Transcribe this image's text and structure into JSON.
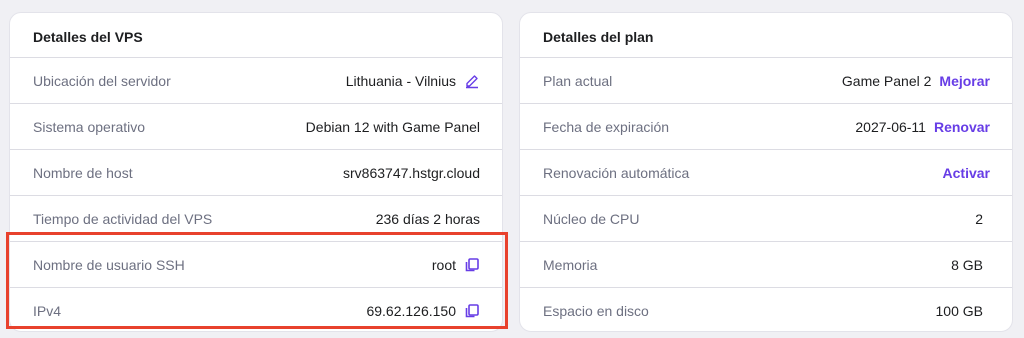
{
  "vps": {
    "title": "Detalles del VPS",
    "rows": [
      {
        "label": "Ubicación del servidor",
        "value": "Lithuania - Vilnius",
        "icon": "edit-icon"
      },
      {
        "label": "Sistema operativo",
        "value": "Debian 12 with Game Panel"
      },
      {
        "label": "Nombre de host",
        "value": "srv863747.hstgr.cloud"
      },
      {
        "label": "Tiempo de actividad del VPS",
        "value": "236 días 2 horas"
      },
      {
        "label": "Nombre de usuario SSH",
        "value": "root",
        "icon": "copy-icon"
      },
      {
        "label": "IPv4",
        "value": "69.62.126.150",
        "icon": "copy-icon"
      }
    ]
  },
  "plan": {
    "title": "Detalles del plan",
    "rows": [
      {
        "label": "Plan actual",
        "value": "Game Panel 2",
        "action": "Mejorar"
      },
      {
        "label": "Fecha de expiración",
        "value": "2027-06-11",
        "action": "Renovar"
      },
      {
        "label": "Renovación automática",
        "value": "",
        "action": "Activar"
      },
      {
        "label": "Núcleo de CPU",
        "value": "2"
      },
      {
        "label": "Memoria",
        "value": "8 GB"
      },
      {
        "label": "Espacio en disco",
        "value": "100 GB"
      }
    ]
  },
  "colors": {
    "accent": "#673de6",
    "highlight": "#e8412d"
  }
}
